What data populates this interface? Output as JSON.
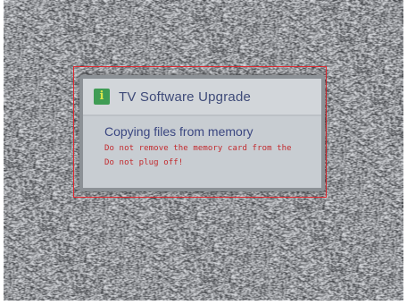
{
  "dialog": {
    "icon": "info-icon",
    "title": "TV Software Upgrade",
    "message": "Copying files from memory",
    "warnings": [
      "Do not remove the memory card from the",
      "Do not plug off!"
    ]
  },
  "colors": {
    "highlight_border": "#e0262e",
    "title_text": "#3e4a78",
    "warning_text": "#c22a2e",
    "icon_bg": "#3f9c54"
  }
}
